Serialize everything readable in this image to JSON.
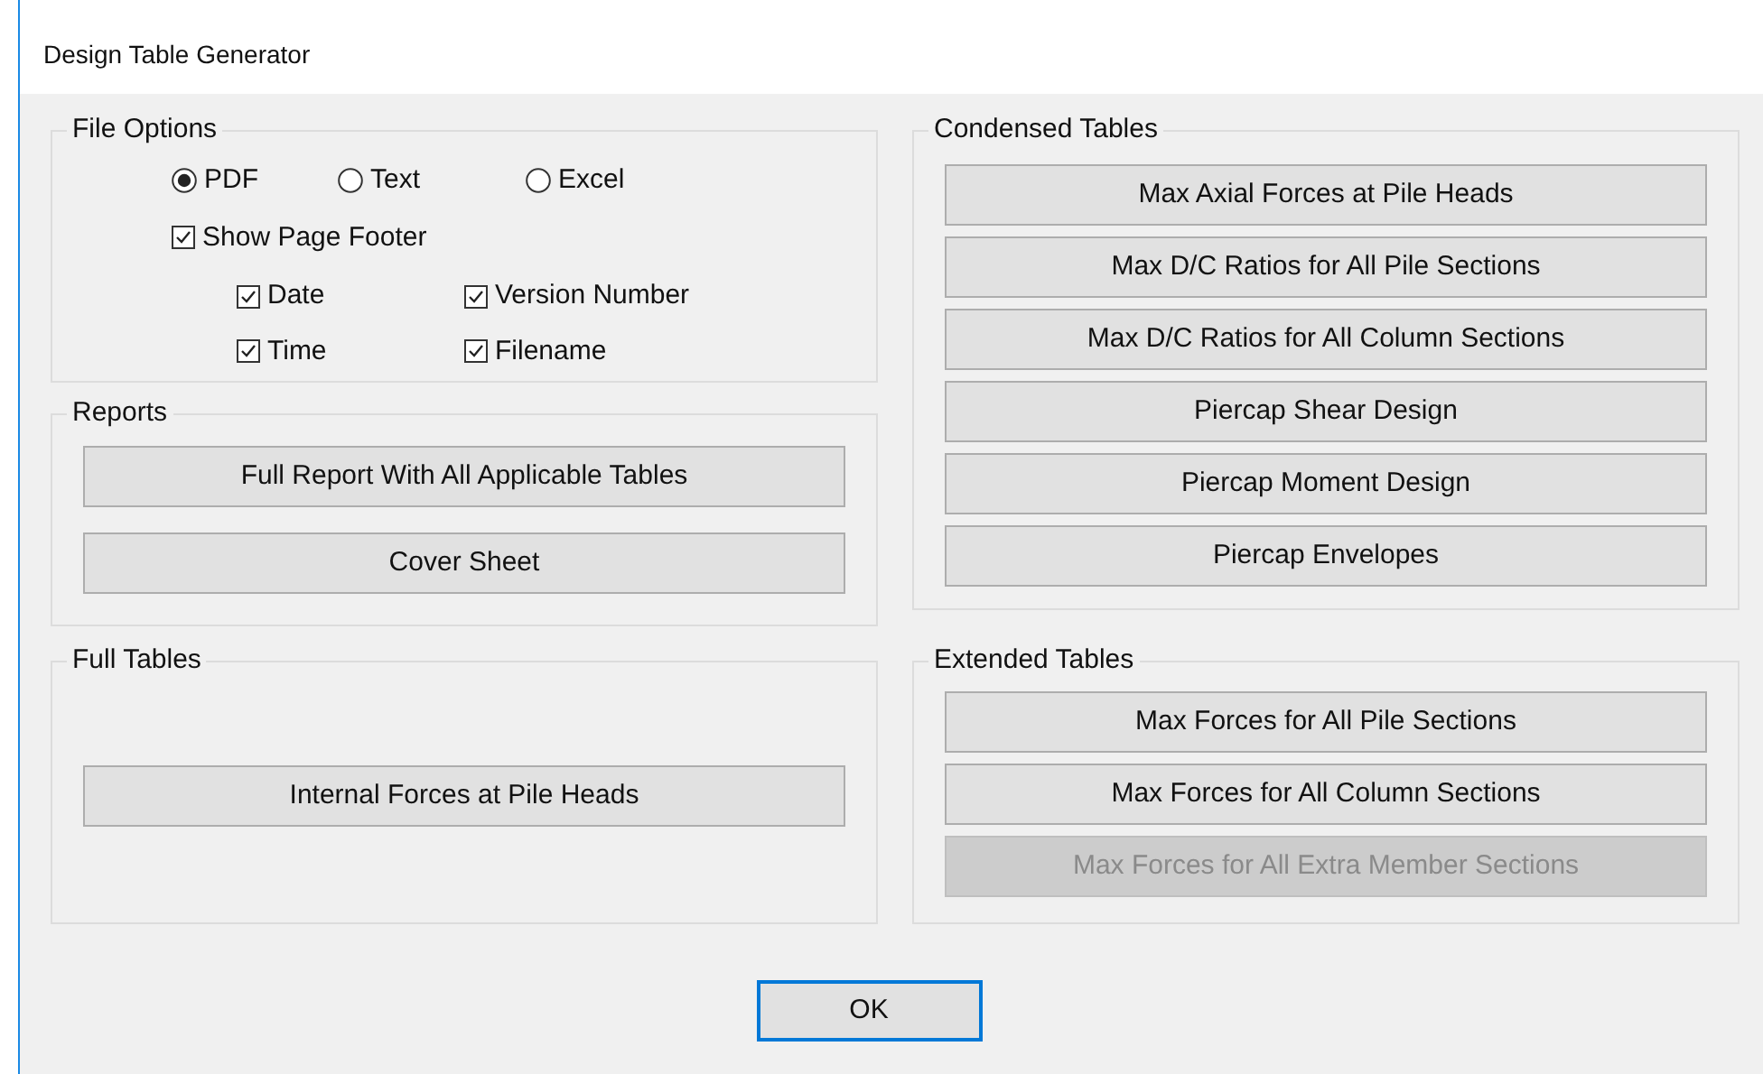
{
  "window": {
    "title": "Design Table Generator"
  },
  "file_options": {
    "title": "File Options",
    "formats": [
      {
        "label": "PDF",
        "selected": true
      },
      {
        "label": "Text",
        "selected": false
      },
      {
        "label": "Excel",
        "selected": false
      }
    ],
    "show_page_footer": {
      "label": "Show Page Footer",
      "checked": true
    },
    "footer_fields": [
      {
        "label": "Date",
        "checked": true
      },
      {
        "label": "Version Number",
        "checked": true
      },
      {
        "label": "Time",
        "checked": true
      },
      {
        "label": "Filename",
        "checked": true
      }
    ]
  },
  "reports": {
    "title": "Reports",
    "buttons": [
      {
        "label": "Full Report With All Applicable Tables"
      },
      {
        "label": "Cover Sheet"
      }
    ]
  },
  "full_tables": {
    "title": "Full Tables",
    "buttons": [
      {
        "label": "Internal Forces at Pile Heads"
      }
    ]
  },
  "condensed_tables": {
    "title": "Condensed Tables",
    "buttons": [
      {
        "label": "Max Axial Forces at Pile Heads"
      },
      {
        "label": "Max D/C Ratios for All Pile Sections"
      },
      {
        "label": "Max D/C Ratios for All Column Sections"
      },
      {
        "label": "Piercap Shear Design"
      },
      {
        "label": "Piercap Moment Design"
      },
      {
        "label": "Piercap Envelopes"
      }
    ]
  },
  "extended_tables": {
    "title": "Extended Tables",
    "buttons": [
      {
        "label": "Max Forces for All Pile Sections",
        "disabled": false
      },
      {
        "label": "Max Forces for All Column Sections",
        "disabled": false
      },
      {
        "label": "Max Forces for All Extra Member Sections",
        "disabled": true
      }
    ]
  },
  "ok_button": {
    "label": "OK"
  }
}
